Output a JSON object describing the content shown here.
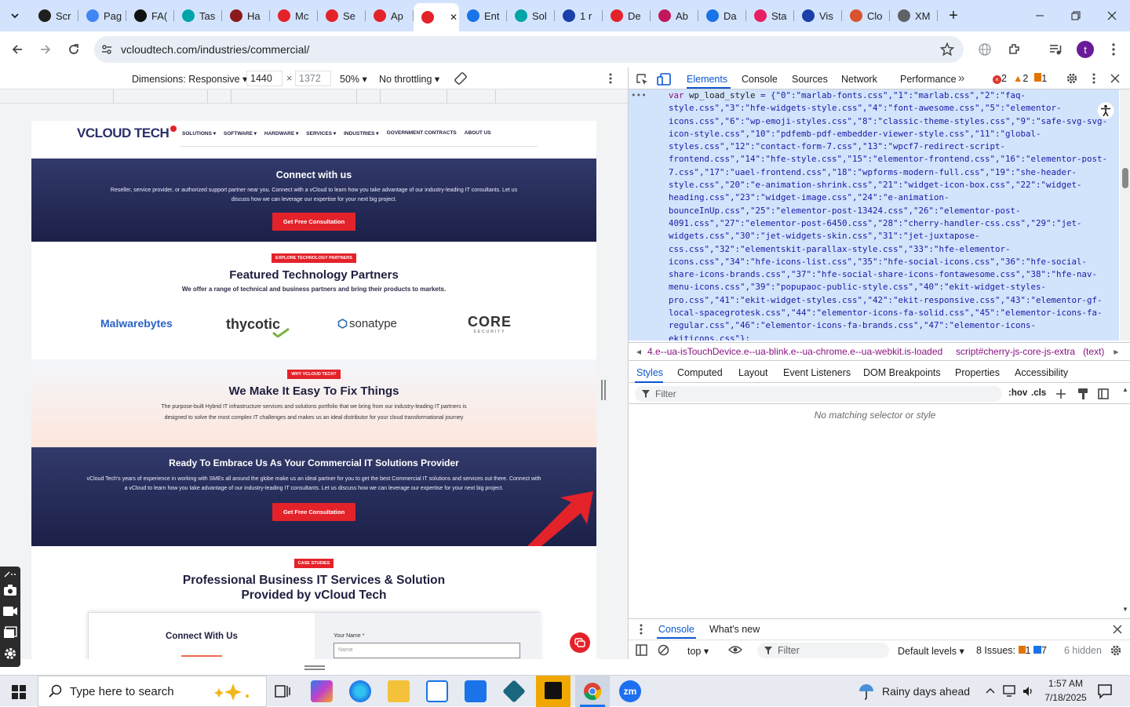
{
  "browser": {
    "tabs": [
      {
        "title": "Scr",
        "icon": "google-icon",
        "color": "#1f1f1f"
      },
      {
        "title": "Pag",
        "icon": "pagespeed-icon",
        "color": "#4285f4"
      },
      {
        "title": "FA(",
        "icon": "openai-icon",
        "color": "#111111"
      },
      {
        "title": "Tas",
        "icon": "task-icon",
        "color": "#00a5a8"
      },
      {
        "title": "Ha",
        "icon": "v-icon",
        "color": "#8b1a1a"
      },
      {
        "title": "Mc",
        "icon": "diamond-icon",
        "color": "#e4222a"
      },
      {
        "title": "Se",
        "icon": "diamond-icon",
        "color": "#e4222a"
      },
      {
        "title": "Ap",
        "icon": "diamond-icon",
        "color": "#e4222a"
      },
      {
        "title": "",
        "icon": "diamond-icon",
        "color": "#e4222a",
        "active": true
      },
      {
        "title": "Ent",
        "icon": "check-icon",
        "color": "#1a73e8"
      },
      {
        "title": "Sol",
        "icon": "sol-icon",
        "color": "#00a5a8"
      },
      {
        "title": "1 r",
        "icon": "x-icon",
        "color": "#1a3fa8"
      },
      {
        "title": "De",
        "icon": "diamond-icon",
        "color": "#e4222a"
      },
      {
        "title": "Ab",
        "icon": "ab-icon",
        "color": "#c2185b"
      },
      {
        "title": "Da",
        "icon": "da-icon",
        "color": "#1a73e8"
      },
      {
        "title": "Sta",
        "icon": "sta-icon",
        "color": "#e91e63"
      },
      {
        "title": "Vis",
        "icon": "vis-icon",
        "color": "#1a3fa8"
      },
      {
        "title": "Clo",
        "icon": "claude-icon",
        "color": "#d9532c"
      },
      {
        "title": "XM",
        "icon": "globe-icon",
        "color": "#5f6368"
      }
    ],
    "url": "vcloudtech.com/industries/commercial/",
    "profile_initial": "t"
  },
  "device_toolbar": {
    "dimensions_label": "Dimensions: Responsive",
    "width": "1440",
    "x": "×",
    "height": "1372",
    "zoom": "50%",
    "throttling": "No throttling"
  },
  "site": {
    "logo_main": "VCLOUD",
    "logo_accent": "TECH",
    "menu": [
      "SOLUTIONS",
      "SOFTWARE",
      "HARDWARE",
      "SERVICES",
      "INDUSTRIES",
      "GOVERNMENT CONTRACTS",
      "ABOUT US"
    ],
    "connect": {
      "title": "Connect with us",
      "text": "Reseller, service provider, or authorized support partner near you. Connect with a vCloud to learn how you take advantage of our industry-leading IT consultants. Let us discuss how we can leverage our expertise for your next big project.",
      "button": "Get Free Consultation"
    },
    "partners": {
      "badge": "EXPLORE TECHNOLOGY PARTNERS",
      "title": "Featured Technology Partners",
      "subtitle": "We offer a range of technical and business partners and bring their products to markets.",
      "logos": [
        "Malwarebytes",
        "thycotic",
        "sonatype",
        "CORE",
        "SECURITY"
      ]
    },
    "why": {
      "badge": "WHY VCLOUD TECH?",
      "title": "We Make It Easy To Fix Things",
      "text": "The purpose-built Hybrid IT infrastructure services and solutions portfolio that we bring from our industry-leading IT partners is designed to solve the most complex IT challenges and makes us an ideal distributor for your cloud transformational journey"
    },
    "ready": {
      "title": "Ready To Embrace Us As Your Commercial IT Solutions Provider",
      "text": "vCloud Tech's years of experience in working with SMEs all around the globe make us an ideal partner for you to get the best Commercial IT solutions and services out there. Connect with a vCloud to learn how you take advantage of our industry-leading IT consultants. Let us discuss how we can leverage our expertise for your next big project.",
      "button": "Get Free Consultation"
    },
    "cases": {
      "badge": "CASE STUDIES",
      "title_line1": "Professional Business IT Services & Solution",
      "title_line2": "Provided by vCloud Tech",
      "form_heading": "Connect With Us",
      "name_label": "Your Name *",
      "name_placeholder": "Name"
    }
  },
  "devtools": {
    "tabs": [
      "Elements",
      "Console",
      "Sources",
      "Network",
      "Performance"
    ],
    "errors": "2",
    "warnings": "2",
    "info": "1",
    "code_lines": [
      [
        "var ",
        "wp_load_style",
        " = {\"0\":\"marlab-fonts.css\",\"1\":\"marlab.css\",\"2\":\"faq-"
      ],
      [
        "",
        "",
        "style.css\",\"3\":\"hfe-widgets-style.css\",\"4\":\"font-awesome.css\",\"5\":\"elementor-"
      ],
      [
        "",
        "",
        "icons.css\",\"6\":\"wp-emoji-styles.css\",\"8\":\"classic-theme-styles.css\",\"9\":\"safe-svg-svg-"
      ],
      [
        "",
        "",
        "icon-style.css\",\"10\":\"pdfemb-pdf-embedder-viewer-style.css\",\"11\":\"global-"
      ],
      [
        "",
        "",
        "styles.css\",\"12\":\"contact-form-7.css\",\"13\":\"wpcf7-redirect-script-"
      ],
      [
        "",
        "",
        "frontend.css\",\"14\":\"hfe-style.css\",\"15\":\"elementor-frontend.css\",\"16\":\"elementor-post-"
      ],
      [
        "",
        "",
        "7.css\",\"17\":\"uael-frontend.css\",\"18\":\"wpforms-modern-full.css\",\"19\":\"she-header-"
      ],
      [
        "",
        "",
        "style.css\",\"20\":\"e-animation-shrink.css\",\"21\":\"widget-icon-box.css\",\"22\":\"widget-"
      ],
      [
        "",
        "",
        "heading.css\",\"23\":\"widget-image.css\",\"24\":\"e-animation-"
      ],
      [
        "",
        "",
        "bounceInUp.css\",\"25\":\"elementor-post-13424.css\",\"26\":\"elementor-post-"
      ],
      [
        "",
        "",
        "4091.css\",\"27\":\"elementor-post-6450.css\",\"28\":\"cherry-handler-css.css\",\"29\":\"jet-"
      ],
      [
        "",
        "",
        "widgets.css\",\"30\":\"jet-widgets-skin.css\",\"31\":\"jet-juxtapose-"
      ],
      [
        "",
        "",
        "css.css\",\"32\":\"elementskit-parallax-style.css\",\"33\":\"hfe-elementor-"
      ],
      [
        "",
        "",
        "icons.css\",\"34\":\"hfe-icons-list.css\",\"35\":\"hfe-social-icons.css\",\"36\":\"hfe-social-"
      ],
      [
        "",
        "",
        "share-icons-brands.css\",\"37\":\"hfe-social-share-icons-fontawesome.css\",\"38\":\"hfe-nav-"
      ],
      [
        "",
        "",
        "menu-icons.css\",\"39\":\"popupaoc-public-style.css\",\"40\":\"ekit-widget-styles-"
      ],
      [
        "",
        "",
        "pro.css\",\"41\":\"ekit-widget-styles.css\",\"42\":\"ekit-responsive.css\",\"43\":\"elementor-gf-"
      ],
      [
        "",
        "",
        "local-spacegrotesk.css\",\"44\":\"elementor-icons-fa-solid.css\",\"45\":\"elementor-icons-fa-"
      ],
      [
        "",
        "",
        "regular.css\",\"46\":\"elementor-icons-fa-brands.css\",\"47\":\"elementor-icons-"
      ],
      [
        "",
        "",
        "ekiticons.css\"};"
      ]
    ],
    "breadcrumb_1": "4.e--ua-isTouchDevice.e--ua-blink.e--ua-chrome.e--ua-webkit.is-loaded",
    "breadcrumb_2": "script#cherry-js-core-js-extra",
    "breadcrumb_3": "(text)",
    "styles_tabs": [
      "Styles",
      "Computed",
      "Layout",
      "Event Listeners",
      "DOM Breakpoints",
      "Properties",
      "Accessibility"
    ],
    "filter_placeholder": "Filter",
    "hov": ":hov",
    "cls": ".cls",
    "no_match": "No matching selector or style",
    "drawer_tabs": [
      "Console",
      "What's new"
    ],
    "console_context": "top",
    "console_filter": "Filter",
    "default_levels": "Default levels",
    "issues_label": "8 Issues:",
    "issues_warn": "1",
    "issues_info": "7",
    "hidden": "6 hidden"
  },
  "taskbar": {
    "search_placeholder": "Type here to search",
    "weather": "Rainy days ahead",
    "time": "1:57 AM",
    "date": "7/18/2025"
  }
}
